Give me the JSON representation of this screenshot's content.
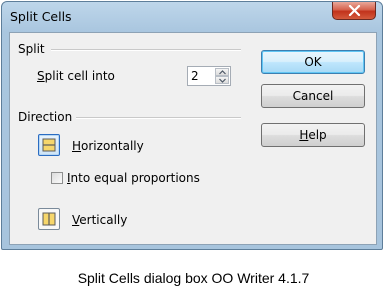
{
  "dialog": {
    "title": "Split Cells",
    "close_icon": "close-icon"
  },
  "split": {
    "section_label": "Split",
    "field_label_mnemonic": "S",
    "field_label_rest": "plit cell into",
    "value": "2"
  },
  "direction": {
    "section_label": "Direction",
    "horizontal_mnemonic": "H",
    "horizontal_rest": "orizontally",
    "horizontal_icon": "split-horizontal-icon",
    "horizontal_selected": true,
    "equal_mnemonic": "I",
    "equal_rest": "nto equal proportions",
    "equal_checked": false,
    "vertical_mnemonic": "V",
    "vertical_rest": "ertically",
    "vertical_icon": "split-vertical-icon"
  },
  "buttons": {
    "ok": "OK",
    "cancel": "Cancel",
    "help_mnemonic": "H",
    "help_rest": "elp"
  },
  "caption": "Split Cells  dialog  box OO Writer  4.1.7"
}
